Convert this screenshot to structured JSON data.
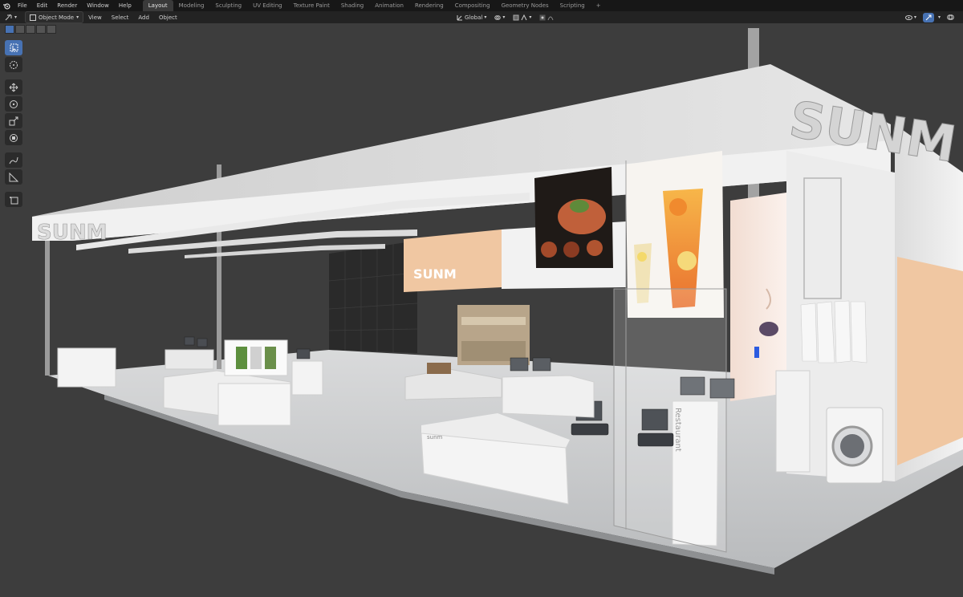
{
  "menu": [
    "File",
    "Edit",
    "Render",
    "Window",
    "Help"
  ],
  "workspaces": [
    "Layout",
    "Modeling",
    "Sculpting",
    "UV Editing",
    "Texture Paint",
    "Shading",
    "Animation",
    "Rendering",
    "Compositing",
    "Geometry Nodes",
    "Scripting"
  ],
  "active_workspace": "Layout",
  "header": {
    "mode": "Object Mode",
    "view": "View",
    "select": "Select",
    "add": "Add",
    "object": "Object",
    "transform_orientation": "Global"
  },
  "tools": [
    "select-box",
    "cursor",
    "move",
    "rotate",
    "scale",
    "transform",
    "annotate",
    "measure",
    "add-cube"
  ],
  "scene": {
    "brand_sign": "SUNM",
    "wall_sign": "SUNM",
    "counter_label": "sunm",
    "kiosk_label": "Restaurant"
  },
  "colors": {
    "accent": "#4772b3",
    "viewport_bg": "#3d3d3d",
    "peach": "#f0c7a2"
  }
}
